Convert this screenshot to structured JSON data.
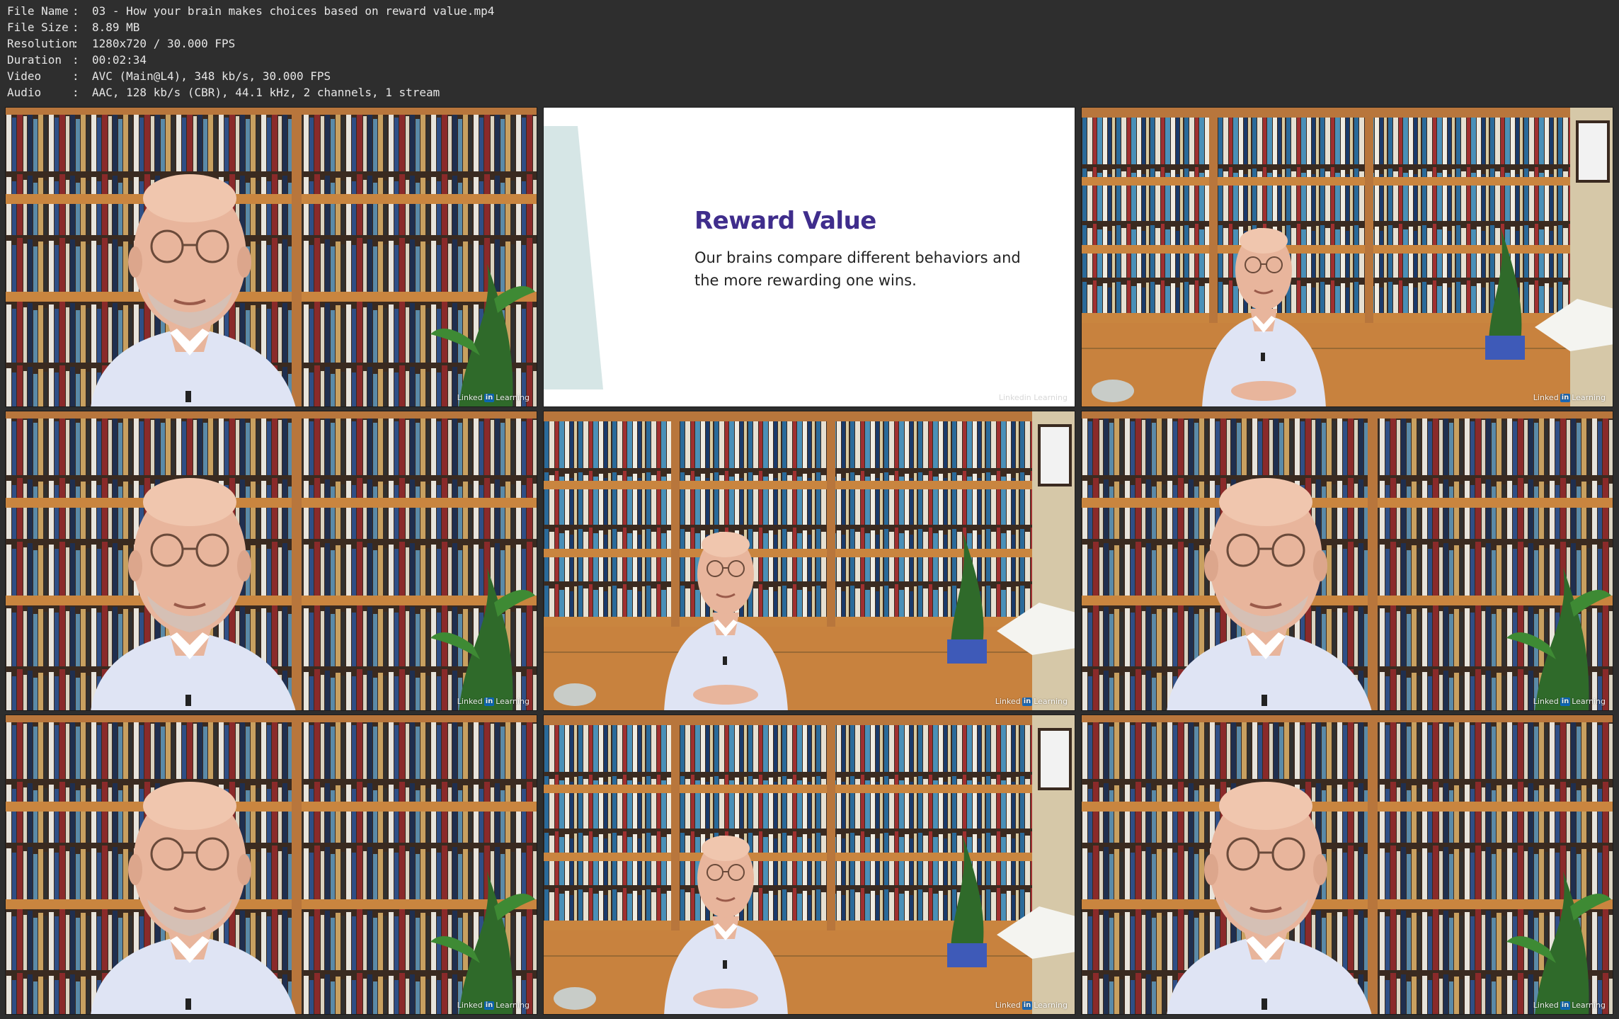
{
  "file_info": [
    {
      "label": "File Name",
      "value": "03 - How your brain makes choices based on reward value.mp4"
    },
    {
      "label": "File Size",
      "value": "8.89 MB"
    },
    {
      "label": "Resolution",
      "value": "1280x720 / 30.000 FPS"
    },
    {
      "label": "Duration",
      "value": "00:02:34"
    },
    {
      "label": "Video",
      "value": "AVC (Main@L4), 348 kb/s, 30.000 FPS"
    },
    {
      "label": "Audio",
      "value": "AAC, 128 kb/s (CBR), 44.1 kHz, 2 channels, 1 stream"
    }
  ],
  "separator": ":",
  "watermark": {
    "brand": "Linked",
    "in": "in",
    "suffix": "Learning"
  },
  "slide": {
    "title": "Reward Value",
    "body": "Our brains compare different behaviors and the more rewarding one wins."
  },
  "colors": {
    "background": "#2e2e2e",
    "header_text": "#e6e6e6",
    "slide_title": "#3f2d8c",
    "slide_accent": "#d6e6e6",
    "shirt": "#dfe4f4",
    "skin": "#e8b59c",
    "shelf_wood": "#b8763c",
    "linkedin_blue": "#0a66c2"
  },
  "thumbnails": [
    {
      "kind": "closeup"
    },
    {
      "kind": "slide"
    },
    {
      "kind": "wide"
    },
    {
      "kind": "closeup"
    },
    {
      "kind": "wide"
    },
    {
      "kind": "closeup"
    },
    {
      "kind": "closeup"
    },
    {
      "kind": "wide"
    },
    {
      "kind": "closeup"
    }
  ]
}
